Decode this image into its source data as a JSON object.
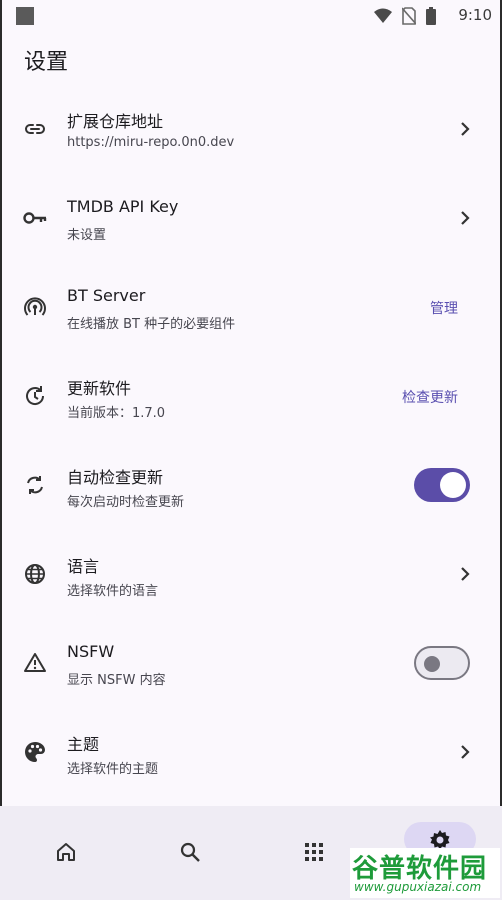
{
  "status_bar": {
    "time": "9:10"
  },
  "page": {
    "title": "设置"
  },
  "settings": [
    {
      "icon": "link-icon",
      "title": "扩展仓库地址",
      "subtitle": "https://miru-repo.0n0.dev",
      "control": "chevron"
    },
    {
      "icon": "key-icon",
      "title": "TMDB API Key",
      "subtitle": "未设置",
      "control": "chevron"
    },
    {
      "icon": "podcast-icon",
      "title": "BT Server",
      "subtitle": "在线播放 BT 种子的必要组件",
      "control": "action",
      "action_label": "管理"
    },
    {
      "icon": "update-icon",
      "title": "更新软件",
      "subtitle": "当前版本：1.7.0",
      "control": "action",
      "action_label": "检查更新"
    },
    {
      "icon": "sync-icon",
      "title": "自动检查更新",
      "subtitle": "每次启动时检查更新",
      "control": "switch",
      "switch_on": true
    },
    {
      "icon": "globe-icon",
      "title": "语言",
      "subtitle": "选择软件的语言",
      "control": "chevron"
    },
    {
      "icon": "warning-icon",
      "title": "NSFW",
      "subtitle": "显示 NSFW 内容",
      "control": "switch",
      "switch_on": false
    },
    {
      "icon": "palette-icon",
      "title": "主题",
      "subtitle": "选择软件的主题",
      "control": "chevron"
    }
  ],
  "bottom_nav": [
    {
      "icon": "home-icon",
      "selected": false
    },
    {
      "icon": "search-icon",
      "selected": false
    },
    {
      "icon": "apps-icon",
      "selected": false
    },
    {
      "icon": "settings-icon",
      "selected": true
    }
  ],
  "watermark": {
    "logo": "谷普软件园",
    "url": "www.gupuxiazai.com"
  },
  "colors": {
    "accent": "#5b4da8",
    "background": "#fbf8fd",
    "nav_background": "#efecf4",
    "watermark_green": "#1e9b3a"
  }
}
